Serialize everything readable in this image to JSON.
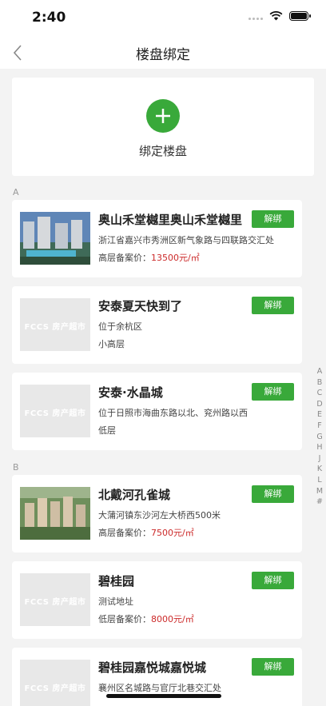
{
  "status": {
    "time": "2:40"
  },
  "nav": {
    "title": "楼盘绑定"
  },
  "bind": {
    "label": "绑定楼盘"
  },
  "sections": [
    {
      "letter": "A",
      "items": [
        {
          "name": "奥山禾堂樾里奥山禾堂樾里",
          "address": "浙江省嘉兴市秀洲区新气象路与四联路交汇处",
          "price_prefix": "高层备案价：",
          "price": "13500元/㎡",
          "line": "",
          "action": "解绑",
          "has_photo": true
        },
        {
          "name": "安泰夏天快到了",
          "address": "位于余杭区",
          "price_prefix": "",
          "price": "",
          "line": "小高层",
          "action": "解绑",
          "has_photo": false
        },
        {
          "name": "安泰·水晶城",
          "address": "位于日照市海曲东路以北、兖州路以西",
          "price_prefix": "",
          "price": "",
          "line": "低层",
          "action": "解绑",
          "has_photo": false
        }
      ]
    },
    {
      "letter": "B",
      "items": [
        {
          "name": "北戴河孔雀城",
          "address": "大蒲河镇东沙河左大桥西500米",
          "price_prefix": "高层备案价：",
          "price": "7500元/㎡",
          "line": "",
          "action": "解绑",
          "has_photo": true
        },
        {
          "name": "碧桂园",
          "address": "测试地址",
          "price_prefix": "低层备案价：",
          "price": "8000元/㎡",
          "line": "",
          "action": "解绑",
          "has_photo": false
        },
        {
          "name": "碧桂园嘉悦城嘉悦城",
          "address": "襄州区名城路与官厅北巷交汇处",
          "price_prefix": "",
          "price": "",
          "line": "",
          "action": "解绑",
          "has_photo": false
        }
      ]
    }
  ],
  "placeholder_logo": "FCCS 房产超市",
  "index_letters": [
    "A",
    "B",
    "C",
    "D",
    "E",
    "F",
    "G",
    "H",
    "J",
    "K",
    "L",
    "M",
    "#"
  ],
  "colors": {
    "accent": "#39a93a",
    "price": "#cc2a2a"
  }
}
